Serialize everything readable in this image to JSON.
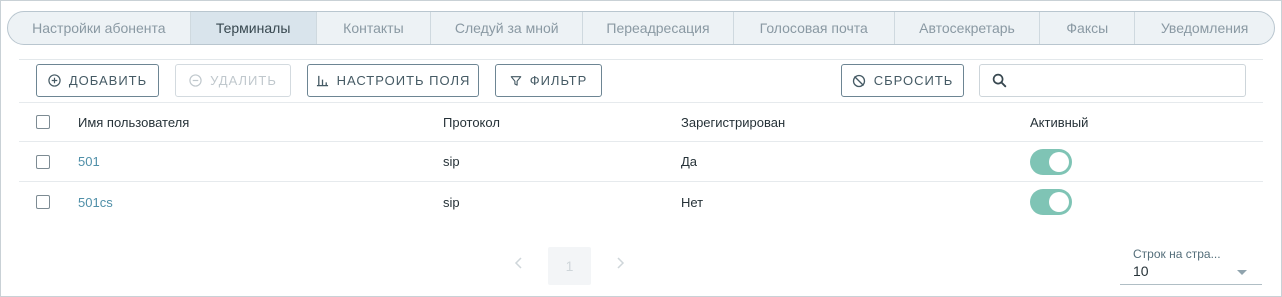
{
  "tabs": [
    {
      "label": "Настройки абонента",
      "active": false
    },
    {
      "label": "Терминалы",
      "active": true
    },
    {
      "label": "Контакты",
      "active": false
    },
    {
      "label": "Следуй за мной",
      "active": false
    },
    {
      "label": "Переадресация",
      "active": false
    },
    {
      "label": "Голосовая почта",
      "active": false
    },
    {
      "label": "Автосекретарь",
      "active": false
    },
    {
      "label": "Факсы",
      "active": false
    },
    {
      "label": "Уведомления",
      "active": false
    }
  ],
  "toolbar": {
    "add_label": "ДОБАВИТЬ",
    "delete_label": "УДАЛИТЬ",
    "configure_label": "НАСТРОИТЬ ПОЛЯ",
    "filter_label": "ФИЛЬТР",
    "reset_label": "СБРОСИТЬ",
    "search_placeholder": "",
    "search_value": ""
  },
  "table": {
    "columns": [
      "Имя пользователя",
      "Протокол",
      "Зарегистрирован",
      "Активный"
    ],
    "rows": [
      {
        "username": "501",
        "protocol": "sip",
        "registered": "Да",
        "active": true
      },
      {
        "username": "501cs",
        "protocol": "sip",
        "registered": "Нет",
        "active": true
      }
    ]
  },
  "pagination": {
    "current_page": "1",
    "rows_per_page_label": "Строк на стра...",
    "rows_per_page_value": "10"
  },
  "colors": {
    "accent": "#4f8fa8",
    "toggle_on": "#7fc4b5",
    "tab_active_bg": "#d9e4ec"
  },
  "icons": {
    "add": "plus-circle-icon",
    "delete": "minus-circle-icon",
    "configure": "columns-icon",
    "filter": "funnel-icon",
    "reset": "reset-icon",
    "search": "search-icon",
    "prev": "chevron-left-icon",
    "next": "chevron-right-icon"
  }
}
